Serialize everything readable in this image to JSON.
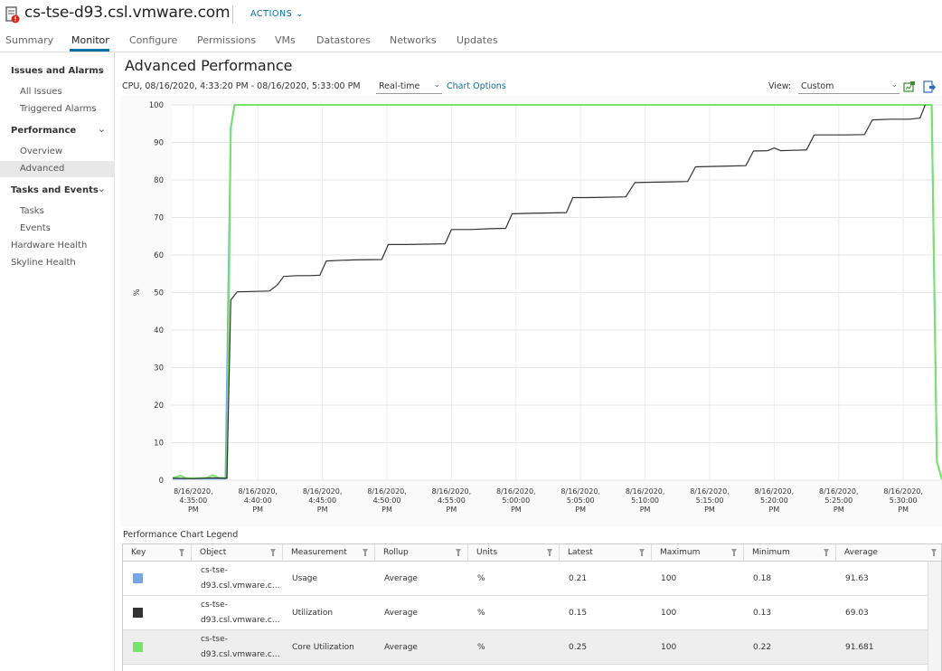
{
  "header": {
    "title": "cs-tse-d93.csl.vmware.com",
    "actions_label": "ACTIONS",
    "host_icon": "host-alert-icon",
    "alert_color": "#d9271c"
  },
  "tabs": [
    {
      "label": "Summary",
      "active": false
    },
    {
      "label": "Monitor",
      "active": true
    },
    {
      "label": "Configure",
      "active": false
    },
    {
      "label": "Permissions",
      "active": false
    },
    {
      "label": "VMs",
      "active": false
    },
    {
      "label": "Datastores",
      "active": false
    },
    {
      "label": "Networks",
      "active": false
    },
    {
      "label": "Updates",
      "active": false
    }
  ],
  "sidebar": {
    "groups": [
      {
        "label": "Issues and Alarms",
        "items": [
          "All Issues",
          "Triggered Alarms"
        ]
      },
      {
        "label": "Performance",
        "items": [
          "Overview",
          "Advanced"
        ]
      },
      {
        "label": "Tasks and Events",
        "items": [
          "Tasks",
          "Events"
        ]
      }
    ],
    "top_items": [
      "Hardware Health",
      "Skyline Health"
    ],
    "selected": "Advanced"
  },
  "main": {
    "title": "Advanced Performance",
    "chart_header": "CPU, 08/16/2020, 4:33:20 PM - 08/16/2020, 5:33:00 PM",
    "period_select": "Real-time",
    "chart_options": "Chart Options",
    "view_label": "View:",
    "view_select": "Custom",
    "icons": [
      "popout-chart-icon",
      "export-icon"
    ]
  },
  "chart_data": {
    "type": "line",
    "ylabel": "%",
    "ylim": [
      0,
      100
    ],
    "yticks": [
      0,
      10,
      20,
      30,
      40,
      50,
      60,
      70,
      80,
      90,
      100
    ],
    "xlim": [
      "4:33:20 PM",
      "5:33:00 PM"
    ],
    "xtick_labels": [
      [
        "8/16/2020,",
        "4:35:00",
        "PM"
      ],
      [
        "8/16/2020,",
        "4:40:00",
        "PM"
      ],
      [
        "8/16/2020,",
        "4:45:00",
        "PM"
      ],
      [
        "8/16/2020,",
        "4:50:00",
        "PM"
      ],
      [
        "8/16/2020,",
        "4:55:00",
        "PM"
      ],
      [
        "8/16/2020,",
        "5:00:00",
        "PM"
      ],
      [
        "8/16/2020,",
        "5:05:00",
        "PM"
      ],
      [
        "8/16/2020,",
        "5:10:00",
        "PM"
      ],
      [
        "8/16/2020,",
        "5:15:00",
        "PM"
      ],
      [
        "8/16/2020,",
        "5:20:00",
        "PM"
      ],
      [
        "8/16/2020,",
        "5:25:00",
        "PM"
      ],
      [
        "8/16/2020,",
        "5:30:00",
        "PM"
      ]
    ],
    "xtick_minutes": [
      95,
      100,
      105,
      110,
      115,
      120,
      125,
      130,
      135,
      140,
      145,
      150
    ],
    "x_start_minute": 93.33,
    "x_end_minute": 153,
    "grid": true,
    "series": [
      {
        "name": "Utilization",
        "color": "#333333",
        "points": [
          [
            93.4,
            0.5
          ],
          [
            95,
            0.4
          ],
          [
            96.5,
            0.6
          ],
          [
            97.6,
            0.5
          ],
          [
            97.9,
            48
          ],
          [
            98.4,
            50.2
          ],
          [
            99.5,
            50.3
          ],
          [
            100.9,
            50.4
          ],
          [
            101.5,
            52
          ],
          [
            102,
            54.3
          ],
          [
            103,
            54.5
          ],
          [
            104,
            54.5
          ],
          [
            104.8,
            54.6
          ],
          [
            105.3,
            58.4
          ],
          [
            106.5,
            58.6
          ],
          [
            107.5,
            58.7
          ],
          [
            109.6,
            58.8
          ],
          [
            110.1,
            62.8
          ],
          [
            111.5,
            62.8
          ],
          [
            113,
            62.9
          ],
          [
            114.5,
            63
          ],
          [
            115,
            66.8
          ],
          [
            116.5,
            66.8
          ],
          [
            118,
            67
          ],
          [
            119.2,
            67.1
          ],
          [
            119.7,
            71
          ],
          [
            121,
            71.1
          ],
          [
            122.5,
            71.2
          ],
          [
            123.9,
            71.3
          ],
          [
            124.4,
            75.3
          ],
          [
            125.5,
            75.3
          ],
          [
            127,
            75.4
          ],
          [
            128.5,
            75.5
          ],
          [
            129.2,
            79.3
          ],
          [
            130.5,
            79.4
          ],
          [
            132,
            79.5
          ],
          [
            133.3,
            79.6
          ],
          [
            133.9,
            83.5
          ],
          [
            135,
            83.6
          ],
          [
            136.5,
            83.7
          ],
          [
            137.8,
            83.8
          ],
          [
            138.4,
            87.7
          ],
          [
            139.5,
            87.8
          ],
          [
            140,
            88.5
          ],
          [
            140.5,
            87.8
          ],
          [
            141.5,
            87.9
          ],
          [
            142.5,
            88
          ],
          [
            143.1,
            92
          ],
          [
            144,
            92
          ],
          [
            145.5,
            92
          ],
          [
            147,
            92.1
          ],
          [
            147.6,
            96
          ],
          [
            149,
            96.2
          ],
          [
            150.5,
            96.2
          ],
          [
            151.3,
            96.5
          ],
          [
            151.7,
            100
          ]
        ]
      },
      {
        "name": "Usage",
        "color": "#73a9e6",
        "points": [
          [
            93.4,
            0.4
          ],
          [
            97.5,
            0.4
          ],
          [
            97.9,
            94
          ],
          [
            98.2,
            100
          ],
          [
            152.2,
            100
          ],
          [
            152.6,
            5
          ],
          [
            153,
            0.2
          ]
        ]
      },
      {
        "name": "Core Utilization",
        "color": "#78e36a",
        "points": [
          [
            93.4,
            0.6
          ],
          [
            94,
            1.2
          ],
          [
            94.5,
            0.5
          ],
          [
            96,
            0.6
          ],
          [
            96.5,
            1.3
          ],
          [
            97,
            0.6
          ],
          [
            97.6,
            0.6
          ],
          [
            97.9,
            94
          ],
          [
            98.2,
            100
          ],
          [
            152.2,
            100
          ],
          [
            152.6,
            5
          ],
          [
            153,
            0.3
          ]
        ]
      }
    ]
  },
  "legend": {
    "title": "Performance Chart Legend",
    "columns": [
      "Key",
      "Object",
      "Measurement",
      "Rollup",
      "Units",
      "Latest",
      "Maximum",
      "Minimum",
      "Average"
    ],
    "rows": [
      {
        "key_color": "#73a9e6",
        "object1": "cs-tse-",
        "object2": "d93.csl.vmware.c...",
        "measurement": "Usage",
        "rollup": "Average",
        "units": "%",
        "latest": "0.21",
        "maximum": "100",
        "minimum": "0.18",
        "average": "91.63",
        "selected": false
      },
      {
        "key_color": "#333333",
        "object1": "cs-tse-",
        "object2": "d93.csl.vmware.c...",
        "measurement": "Utilization",
        "rollup": "Average",
        "units": "%",
        "latest": "0.15",
        "maximum": "100",
        "minimum": "0.13",
        "average": "69.03",
        "selected": false
      },
      {
        "key_color": "#78e36a",
        "object1": "cs-tse-",
        "object2": "d93.csl.vmware.c...",
        "measurement": "Core Utilization",
        "rollup": "Average",
        "units": "%",
        "latest": "0.25",
        "maximum": "100",
        "minimum": "0.22",
        "average": "91.681",
        "selected": true
      }
    ]
  }
}
